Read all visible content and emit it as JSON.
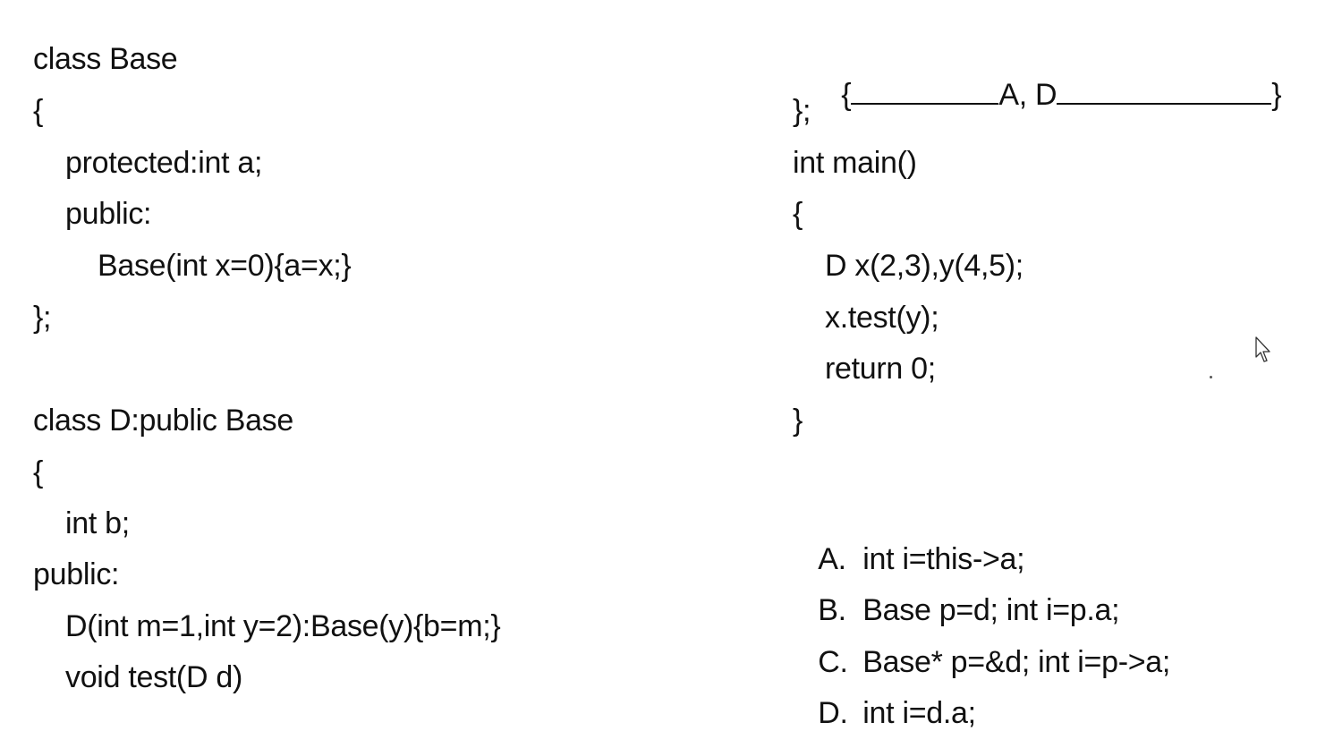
{
  "left_code": {
    "l1": "class Base",
    "l2": "{",
    "l3": "protected:int a;",
    "l4": "public:",
    "l5": "Base(int x=0){a=x;}",
    "l6": "};",
    "l7": "class D:public Base",
    "l8": "{",
    "l9": "int b;",
    "l10": "public:",
    "l11": "D(int m=1,int y=2):Base(y){b=m;}",
    "l12": "void test(D d)"
  },
  "right_code": {
    "blank_open": "{",
    "blank_answer": "A, D",
    "blank_close": "}",
    "r2": "};",
    "r3": "int main()",
    "r4": "{",
    "r5": "D x(2,3),y(4,5);",
    "r6": "x.test(y);",
    "r7": "return 0;",
    "r8": "}"
  },
  "options": [
    {
      "letter": "A.",
      "text": "int i=this->a;"
    },
    {
      "letter": "B.",
      "text": "Base p=d; int i=p.a;"
    },
    {
      "letter": "C.",
      "text": "Base* p=&d; int i=p->a;"
    },
    {
      "letter": "D.",
      "text": "int i=d.a;"
    }
  ],
  "icons": {
    "cursor": "mouse-pointer-icon"
  }
}
